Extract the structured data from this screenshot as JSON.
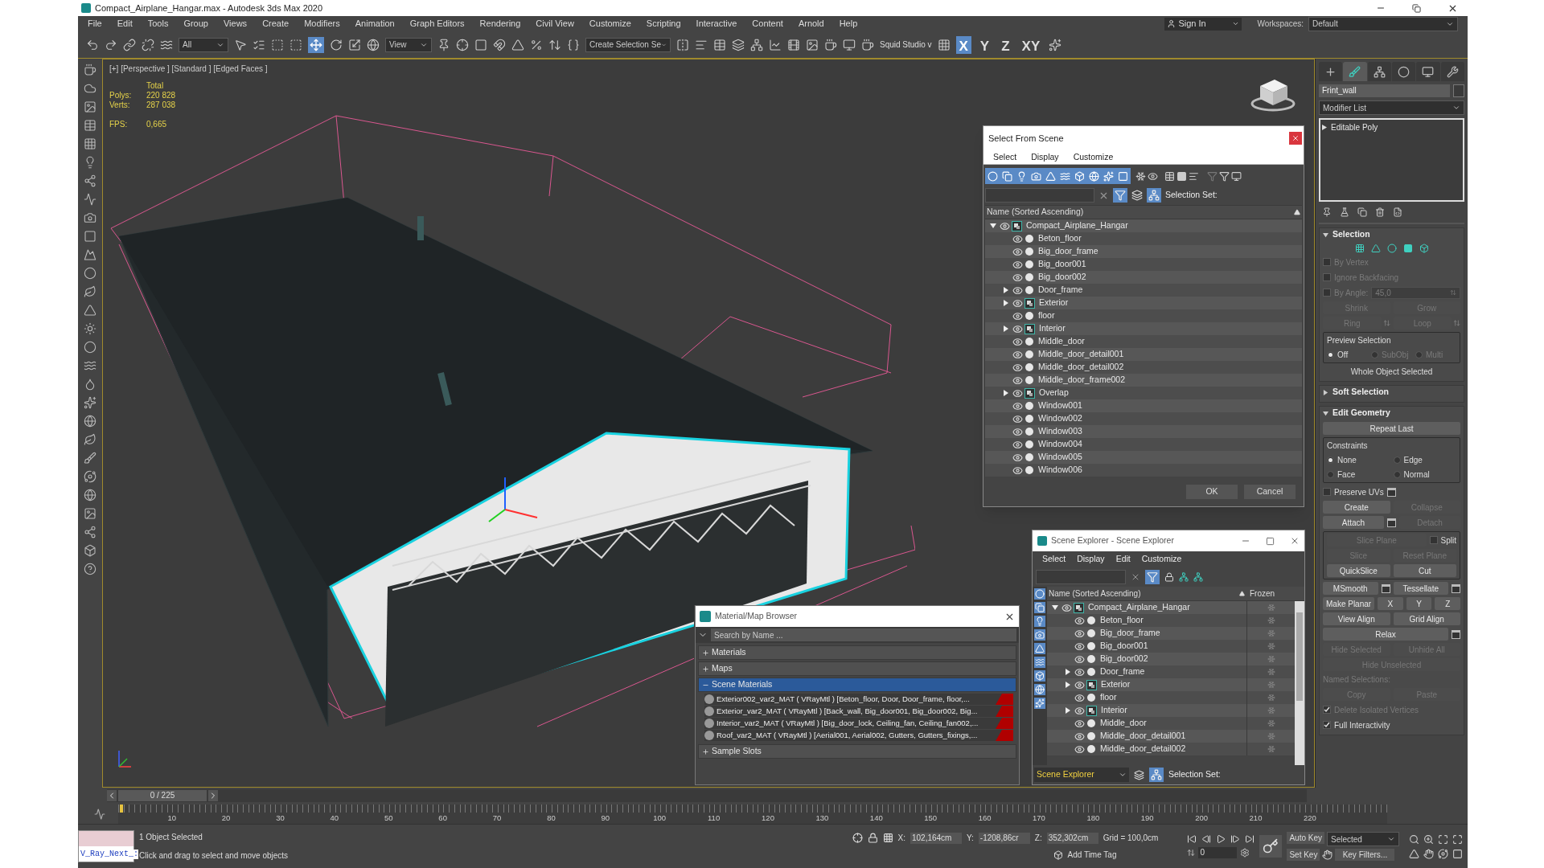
{
  "window": {
    "title": "Compact_Airplane_Hangar.max - Autodesk 3ds Max 2020"
  },
  "menu": [
    "File",
    "Edit",
    "Tools",
    "Group",
    "Views",
    "Create",
    "Modifiers",
    "Animation",
    "Graph Editors",
    "Rendering",
    "Civil View",
    "Customize",
    "Scripting",
    "Interactive",
    "Content",
    "Arnold",
    "Help"
  ],
  "sign_in": "Sign In",
  "workspaces": {
    "label": "Workspaces:",
    "value": "Default"
  },
  "toolbar": {
    "selection_filter": "All",
    "reference_coord": "View",
    "named_selection": "Create Selection Se",
    "studio": "Squid Studio v",
    "axis_constraints": [
      {
        "label": "X",
        "selected": true
      },
      {
        "label": "Y",
        "selected": false
      },
      {
        "label": "Z",
        "selected": false
      },
      {
        "label": "XY",
        "selected": false
      }
    ]
  },
  "viewport": {
    "label": "[+] [Perspective ] [Standard ] [Edged Faces ]",
    "stats_header": "Total",
    "stats": [
      {
        "label": "Polys:",
        "value": "220 828"
      },
      {
        "label": "Verts:",
        "value": "287 038"
      }
    ],
    "fps": {
      "label": "FPS:",
      "value": "0,665"
    }
  },
  "select_from_scene": {
    "title": "Select From Scene",
    "menu": [
      "Select",
      "Display",
      "Customize"
    ],
    "selection_set": "Selection Set:",
    "column": "Name (Sorted Ascending)",
    "tree": {
      "name": "Compact_Airplane_Hangar",
      "kind": "group",
      "expandable": true,
      "expanded": true,
      "children": [
        {
          "name": "Beton_floor",
          "kind": "object",
          "expandable": false
        },
        {
          "name": "Big_door_frame",
          "kind": "object",
          "expandable": false
        },
        {
          "name": "Big_door001",
          "kind": "object",
          "expandable": false
        },
        {
          "name": "Big_door002",
          "kind": "object",
          "expandable": false
        },
        {
          "name": "Door_frame",
          "kind": "object",
          "expandable": true,
          "expanded": false
        },
        {
          "name": "Exterior",
          "kind": "group",
          "expandable": true,
          "expanded": false
        },
        {
          "name": "floor",
          "kind": "object",
          "expandable": false
        },
        {
          "name": "Interior",
          "kind": "group",
          "expandable": true,
          "expanded": false
        },
        {
          "name": "Middle_door",
          "kind": "object",
          "expandable": false
        },
        {
          "name": "Middle_door_detail001",
          "kind": "object",
          "expandable": false
        },
        {
          "name": "Middle_door_detail002",
          "kind": "object",
          "expandable": false
        },
        {
          "name": "Middle_door_frame002",
          "kind": "object",
          "expandable": false
        },
        {
          "name": "Overlap",
          "kind": "group",
          "expandable": true,
          "expanded": false
        },
        {
          "name": "Window001",
          "kind": "object",
          "expandable": false
        },
        {
          "name": "Window002",
          "kind": "object",
          "expandable": false
        },
        {
          "name": "Window003",
          "kind": "object",
          "expandable": false
        },
        {
          "name": "Window004",
          "kind": "object",
          "expandable": false
        },
        {
          "name": "Window005",
          "kind": "object",
          "expandable": false
        },
        {
          "name": "Window006",
          "kind": "object",
          "expandable": false
        }
      ]
    },
    "buttons": [
      "OK",
      "Cancel"
    ]
  },
  "material_browser": {
    "title": "Material/Map Browser",
    "search_placeholder": "Search by Name ...",
    "sections": [
      {
        "label": "Materials",
        "expanded": false
      },
      {
        "label": "Maps",
        "expanded": false
      },
      {
        "label": "Scene Materials",
        "expanded": true,
        "items": [
          "Exterior002_var2_MAT ( VRayMtl ) [Beton_floor, Door, Door_frame, floor,...",
          "Exterior_var2_MAT ( VRayMtl ) [Back_wall, Big_door001, Big_door002, Big...",
          "Interior_var2_MAT ( VRayMtl ) [Big_door_lock, Ceiling_fan, Ceiling_fan002,...",
          "Roof_var2_MAT ( VRayMtl ) [Aerial001, Aerial002, Gutters, Gutters_fixings,..."
        ]
      },
      {
        "label": "Sample Slots",
        "expanded": false
      }
    ]
  },
  "scene_explorer": {
    "title": "Scene Explorer - Scene Explorer",
    "menu": [
      "Select",
      "Display",
      "Edit",
      "Customize"
    ],
    "column": "Name (Sorted Ascending)",
    "frozen_column": "Frozen",
    "explorer": "Scene Explorer",
    "selection_set": "Selection Set:",
    "tree": {
      "name": "Compact_Airplane_Hangar",
      "kind": "group",
      "expandable": true,
      "expanded": true,
      "children": [
        {
          "name": "Beton_floor",
          "kind": "object",
          "expandable": false
        },
        {
          "name": "Big_door_frame",
          "kind": "object",
          "expandable": false
        },
        {
          "name": "Big_door001",
          "kind": "object",
          "expandable": false
        },
        {
          "name": "Big_door002",
          "kind": "object",
          "expandable": false
        },
        {
          "name": "Door_frame",
          "kind": "object",
          "expandable": true,
          "expanded": false
        },
        {
          "name": "Exterior",
          "kind": "group",
          "expandable": true,
          "expanded": false
        },
        {
          "name": "floor",
          "kind": "object",
          "expandable": false
        },
        {
          "name": "Interior",
          "kind": "group",
          "expandable": true,
          "expanded": false
        },
        {
          "name": "Middle_door",
          "kind": "object",
          "expandable": false
        },
        {
          "name": "Middle_door_detail001",
          "kind": "object",
          "expandable": false
        },
        {
          "name": "Middle_door_detail002",
          "kind": "object",
          "expandable": false
        }
      ]
    }
  },
  "command_panel": {
    "tabs": [
      {
        "kind": "create",
        "selected": false
      },
      {
        "kind": "modify",
        "selected": true
      },
      {
        "kind": "hierarchy",
        "selected": false
      },
      {
        "kind": "motion",
        "selected": false
      },
      {
        "kind": "display",
        "selected": false
      },
      {
        "kind": "utilities",
        "selected": false
      }
    ],
    "object_name": "Frint_wall",
    "modifier_list": "Modifier List",
    "stack": [
      "Editable Poly"
    ],
    "rollouts": [
      {
        "title": "Selection",
        "expanded": true,
        "rows": [
          [
            {
              "kind": "subobjects"
            }
          ],
          [
            {
              "kind": "checkbox",
              "label": "By Vertex",
              "checked": false,
              "disabled": true
            }
          ],
          [
            {
              "kind": "checkbox",
              "label": "Ignore Backfacing",
              "checked": false,
              "disabled": true
            }
          ],
          [
            {
              "kind": "checkbox",
              "label": "By Angle:",
              "checked": false,
              "disabled": true
            },
            {
              "kind": "spinner",
              "value": "45,0",
              "disabled": true
            }
          ],
          [
            {
              "kind": "button",
              "label": "Shrink",
              "disabled": true
            },
            {
              "kind": "button",
              "label": "Grow",
              "disabled": true
            }
          ],
          [
            {
              "kind": "button",
              "label": "Ring",
              "disabled": true,
              "arrows": true
            },
            {
              "kind": "button",
              "label": "Loop",
              "disabled": true,
              "arrows": true
            }
          ],
          [
            {
              "kind": "group",
              "title": "Preview Selection",
              "rows": [
                [
                  {
                    "kind": "radio",
                    "label": "Off",
                    "selected": true,
                    "disabled": false
                  },
                  {
                    "kind": "radio",
                    "label": "SubObj",
                    "selected": false,
                    "disabled": true
                  },
                  {
                    "kind": "radio",
                    "label": "Multi",
                    "selected": false,
                    "disabled": true
                  }
                ]
              ]
            }
          ],
          [
            {
              "kind": "label",
              "label": "Whole Object Selected",
              "disabled": false
            }
          ]
        ]
      },
      {
        "title": "Soft Selection",
        "expanded": false
      },
      {
        "title": "Edit Geometry",
        "expanded": true,
        "rows": [
          [
            {
              "kind": "button",
              "label": "Repeat Last",
              "disabled": false
            }
          ],
          [
            {
              "kind": "group",
              "title": "Constraints",
              "rows": [
                [
                  {
                    "kind": "radio",
                    "label": "None",
                    "selected": true,
                    "disabled": false
                  },
                  {
                    "kind": "radio",
                    "label": "Edge",
                    "selected": false,
                    "disabled": false
                  }
                ],
                [
                  {
                    "kind": "radio",
                    "label": "Face",
                    "selected": false,
                    "disabled": false
                  },
                  {
                    "kind": "radio",
                    "label": "Normal",
                    "selected": false,
                    "disabled": false
                  }
                ]
              ]
            }
          ],
          [
            {
              "kind": "checkbox",
              "label": "Preserve UVs",
              "checked": false,
              "disabled": false
            },
            {
              "kind": "settings"
            }
          ],
          [
            {
              "kind": "button",
              "label": "Create",
              "disabled": false
            },
            {
              "kind": "button",
              "label": "Collapse",
              "disabled": true
            }
          ],
          [
            {
              "kind": "button",
              "label": "Attach",
              "disabled": false
            },
            {
              "kind": "settings"
            },
            {
              "kind": "button",
              "label": "Detach",
              "disabled": true
            }
          ],
          [
            {
              "kind": "group",
              "rows": [
                [
                  {
                    "kind": "button",
                    "label": "Slice Plane",
                    "disabled": true
                  },
                  {
                    "kind": "checkbox",
                    "label": "Split",
                    "checked": false,
                    "disabled": false
                  }
                ],
                [
                  {
                    "kind": "button",
                    "label": "Slice",
                    "disabled": true
                  },
                  {
                    "kind": "button",
                    "label": "Reset Plane",
                    "disabled": true
                  }
                ],
                [
                  {
                    "kind": "button",
                    "label": "QuickSlice",
                    "disabled": false
                  },
                  {
                    "kind": "button",
                    "label": "Cut",
                    "disabled": false
                  }
                ]
              ]
            }
          ],
          [
            {
              "kind": "button",
              "label": "MSmooth",
              "disabled": false
            },
            {
              "kind": "settings"
            },
            {
              "kind": "button",
              "label": "Tessellate",
              "disabled": false
            },
            {
              "kind": "settings"
            }
          ],
          [
            {
              "kind": "button",
              "label": "Make Planar",
              "disabled": false
            },
            {
              "kind": "button",
              "label": "X",
              "disabled": false
            },
            {
              "kind": "button",
              "label": "Y",
              "disabled": false
            },
            {
              "kind": "button",
              "label": "Z",
              "disabled": false
            }
          ],
          [
            {
              "kind": "button",
              "label": "View Align",
              "disabled": false
            },
            {
              "kind": "button",
              "label": "Grid Align",
              "disabled": false
            }
          ],
          [
            {
              "kind": "button",
              "label": "Relax",
              "disabled": false
            },
            {
              "kind": "settings"
            }
          ],
          [
            {
              "kind": "button",
              "label": "Hide Selected",
              "disabled": true
            },
            {
              "kind": "button",
              "label": "Unhide All",
              "disabled": true
            }
          ],
          [
            {
              "kind": "button",
              "label": "Hide Unselected",
              "disabled": true
            }
          ],
          [
            {
              "kind": "label",
              "label": "Named Selections:",
              "disabled": true
            }
          ],
          [
            {
              "kind": "button",
              "label": "Copy",
              "disabled": true
            },
            {
              "kind": "button",
              "label": "Paste",
              "disabled": true
            }
          ],
          [
            {
              "kind": "checkbox",
              "label": "Delete Isolated Vertices",
              "checked": true,
              "disabled": true
            }
          ],
          [
            {
              "kind": "checkbox",
              "label": "Full Interactivity",
              "checked": true,
              "disabled": false
            }
          ]
        ]
      }
    ]
  },
  "timeline": {
    "frame": "0 / 225",
    "level": 0,
    "ticks": [
      "10",
      "20",
      "30",
      "40",
      "50",
      "60",
      "70",
      "80",
      "90",
      "100",
      "110",
      "120",
      "130",
      "140",
      "150",
      "160",
      "170",
      "180",
      "190",
      "200",
      "210",
      "220"
    ]
  },
  "status": {
    "script": "V_Ray_Next_:",
    "selection": "1 Object Selected",
    "prompt": "Click and drag to select and move objects",
    "coords": [
      {
        "label": "X:",
        "value": "102,164cm"
      },
      {
        "label": "Y:",
        "value": "-1208,86cr"
      },
      {
        "label": "Z:",
        "value": "352,302cm"
      }
    ],
    "grid": "Grid = 100,0cm",
    "time_tag": "Add Time Tag",
    "auto_key": "Auto Key",
    "set_key": "Set Key",
    "key_mode": "Selected",
    "key_filters": "Key Filters...",
    "frame": "0"
  }
}
